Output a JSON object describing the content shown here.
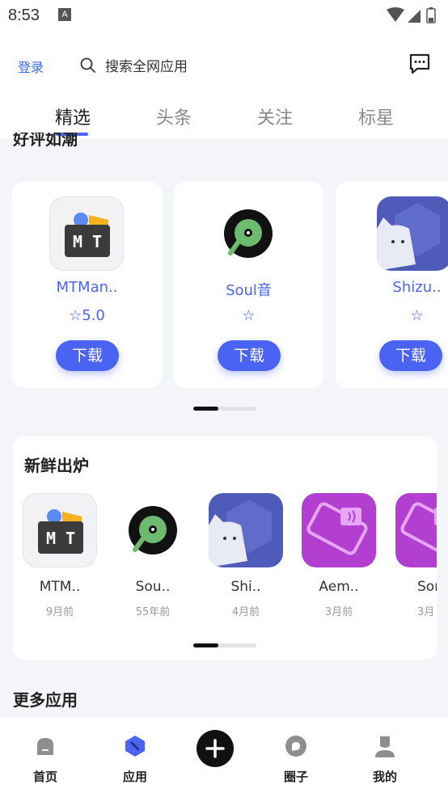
{
  "status": {
    "time": "8:53",
    "notif": "A"
  },
  "top": {
    "login": "登录",
    "search_placeholder": "搜索全网应用"
  },
  "tabs": [
    {
      "label": "精选"
    },
    {
      "label": "头条"
    },
    {
      "label": "关注"
    },
    {
      "label": "标星"
    }
  ],
  "hot": {
    "title": "好评如潮",
    "items": [
      {
        "name": "MTMan..",
        "rating": "☆5.0",
        "download": "下载"
      },
      {
        "name": "Soul音",
        "rating": "☆",
        "download": "下载"
      },
      {
        "name": "Shizu..",
        "rating": "☆",
        "download": "下载"
      }
    ]
  },
  "new": {
    "title": "新鲜出炉",
    "items": [
      {
        "name": "MTM..",
        "time": "9月前"
      },
      {
        "name": "Sou..",
        "time": "55年前"
      },
      {
        "name": "Shi..",
        "time": "4月前"
      },
      {
        "name": "Aem..",
        "time": "3月前"
      },
      {
        "name": "Sor",
        "time": "3月"
      }
    ]
  },
  "more": {
    "title": "更多应用"
  },
  "nav": [
    {
      "label": "首页"
    },
    {
      "label": "应用"
    },
    {
      "label": "圈子"
    },
    {
      "label": "我的"
    }
  ],
  "colors": {
    "accent": "#4a63f3",
    "link": "#3d6cf2"
  }
}
